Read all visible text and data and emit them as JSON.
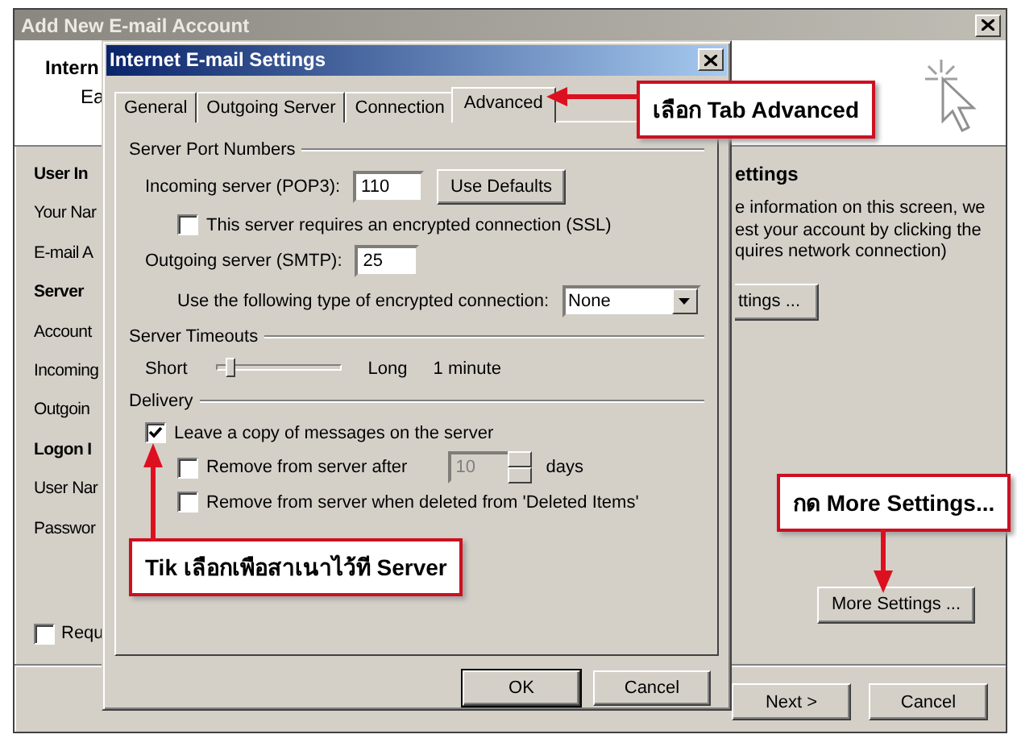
{
  "window": {
    "title": "Add New E-mail Account",
    "header_title": "Intern",
    "header_subtitle": "Ea",
    "left_labels": [
      {
        "text": "User In",
        "kind": "heading"
      },
      {
        "text": "Your Nar",
        "kind": "label"
      },
      {
        "text": "E-mail A",
        "kind": "label"
      },
      {
        "text": "Server",
        "kind": "heading"
      },
      {
        "text": "Account",
        "kind": "label"
      },
      {
        "text": "Incoming",
        "kind": "label"
      },
      {
        "text": "Outgoin",
        "kind": "label"
      },
      {
        "text": "Logon I",
        "kind": "heading"
      },
      {
        "text": "User Nar",
        "kind": "label"
      },
      {
        "text": "Passwor",
        "kind": "label"
      }
    ],
    "require_checkbox": {
      "label": "Requ",
      "checked": false
    },
    "right_heading": "ettings",
    "right_lines": [
      "e information on this screen, we",
      "est your account by clicking the",
      "quires network connection)"
    ],
    "test_button": "ttings ...",
    "more_settings_button": "More Settings ...",
    "buttons": [
      "Next >",
      "Cancel"
    ]
  },
  "dialog": {
    "title": "Internet E-mail Settings",
    "tabs": [
      {
        "label": "General",
        "selected": false
      },
      {
        "label": "Outgoing Server",
        "selected": false
      },
      {
        "label": "Connection",
        "selected": false
      },
      {
        "label": "Advanced",
        "selected": true
      }
    ],
    "port_group": "Server Port Numbers",
    "incoming_label": "Incoming server (POP3):",
    "incoming_value": "110",
    "use_defaults": "Use Defaults",
    "ssl_checkbox": {
      "label": "This server requires an encrypted connection (SSL)",
      "checked": false
    },
    "outgoing_label": "Outgoing server (SMTP):",
    "outgoing_value": "25",
    "encryption_label": "Use the following type of encrypted connection:",
    "encryption_value": "None",
    "timeout_group": "Server Timeouts",
    "timeout_short": "Short",
    "timeout_long": "Long",
    "timeout_reading": "1 minute",
    "timeout_slider": {
      "level": 0.08
    },
    "delivery_group": "Delivery",
    "leave_copy": {
      "label": "Leave a copy of messages on the server",
      "checked": true
    },
    "remove_after": {
      "label": "Remove from server after",
      "checked": false,
      "days_value": "10",
      "days_disabled": true,
      "unit": "days"
    },
    "remove_deleted": {
      "label": "Remove from server when deleted from 'Deleted Items'",
      "checked": false
    },
    "buttons": [
      "OK",
      "Cancel"
    ]
  },
  "annotations": [
    {
      "text": "เลือก Tab Advanced",
      "kind": "left"
    },
    {
      "text": "Tik เลือกเพือสาเนาไว้ที Server",
      "kind": "up"
    },
    {
      "text": "กด More Settings...",
      "kind": "down"
    }
  ]
}
